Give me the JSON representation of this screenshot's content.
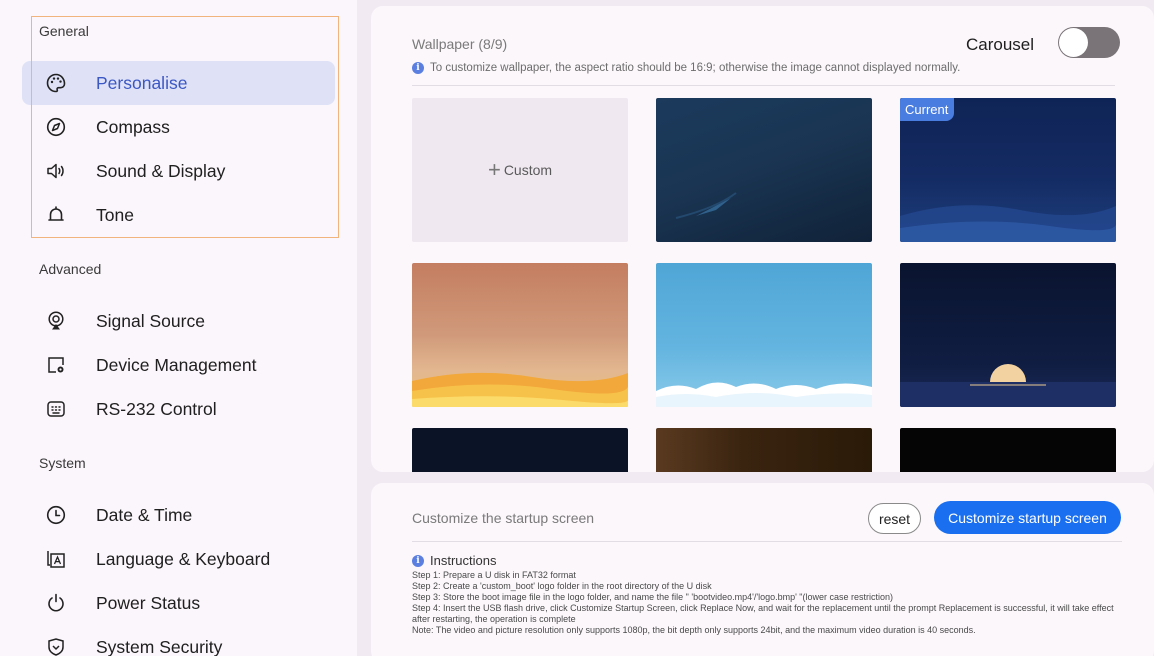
{
  "sidebar": {
    "sections": {
      "general": "General",
      "advanced": "Advanced",
      "system": "System"
    },
    "items": [
      {
        "label": "Personalise",
        "icon": "palette-icon",
        "active": true
      },
      {
        "label": "Compass",
        "icon": "compass-icon"
      },
      {
        "label": "Sound & Display",
        "icon": "speaker-icon"
      },
      {
        "label": "Tone",
        "icon": "bell-icon"
      },
      {
        "label": "Signal Source",
        "icon": "signal-icon"
      },
      {
        "label": "Device Management",
        "icon": "device-settings-icon"
      },
      {
        "label": "RS-232 Control",
        "icon": "keyboard-port-icon"
      },
      {
        "label": "Date & Time",
        "icon": "clock-icon"
      },
      {
        "label": "Language & Keyboard",
        "icon": "language-icon"
      },
      {
        "label": "Power Status",
        "icon": "power-icon"
      },
      {
        "label": "System Security",
        "icon": "shield-icon"
      }
    ]
  },
  "wallpaper": {
    "title": "Wallpaper (8/9)",
    "carousel_label": "Carousel",
    "carousel_on": false,
    "hint": "To customize wallpaper, the aspect ratio should be 16:9; otherwise the image cannot displayed normally.",
    "custom_label": "Custom",
    "custom_plus": "+",
    "current_badge": "Current"
  },
  "startup": {
    "title": "Customize the startup screen",
    "reset_label": "reset",
    "customize_label": "Customize startup screen",
    "instructions_title": "Instructions",
    "steps": [
      "Step 1: Prepare a U disk in FAT32 format",
      "Step 2: Create a 'custom_boot' logo folder in the root directory of the U disk",
      "Step 3: Store the boot image file in the logo folder, and name the file \" 'bootvideo.mp4'/'logo.bmp' \"(lower case restriction)",
      "Step 4: Insert the USB flash drive, click Customize Startup Screen, click Replace Now, and wait for the replacement until the prompt Replacement is successful, it will take effect after restarting, the operation is complete",
      "Note: The video and picture resolution only supports 1080p, the bit depth only supports 24bit, and the maximum video duration is 40 seconds."
    ]
  },
  "colors": {
    "accent": "#1a6ff0",
    "active_bg": "#dfe2f7",
    "highlight_border": "#f0b47c"
  }
}
